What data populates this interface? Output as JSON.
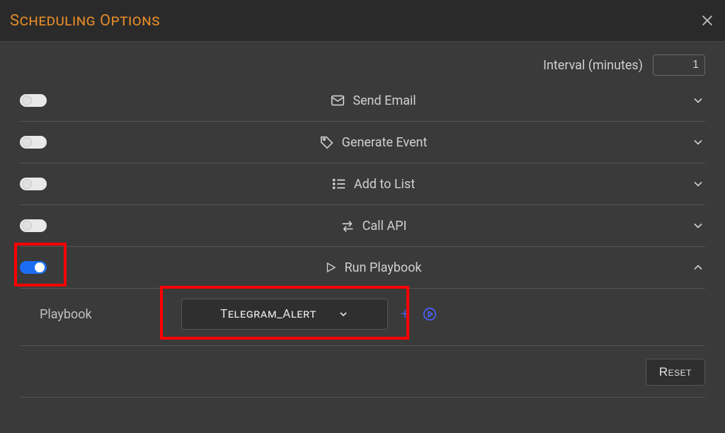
{
  "header": {
    "title": "Scheduling Options"
  },
  "interval": {
    "label": "Interval (minutes)",
    "value": "1"
  },
  "actions": [
    {
      "icon": "email",
      "label": "Send Email",
      "enabled": false,
      "expanded": false
    },
    {
      "icon": "tag",
      "label": "Generate Event",
      "enabled": false,
      "expanded": false
    },
    {
      "icon": "list",
      "label": "Add to List",
      "enabled": false,
      "expanded": false
    },
    {
      "icon": "swap",
      "label": "Call API",
      "enabled": false,
      "expanded": false
    },
    {
      "icon": "play",
      "label": "Run Playbook",
      "enabled": true,
      "expanded": true
    }
  ],
  "playbook": {
    "field_label": "Playbook",
    "selected": "Telegram_Alert"
  },
  "buttons": {
    "reset": "Reset"
  }
}
